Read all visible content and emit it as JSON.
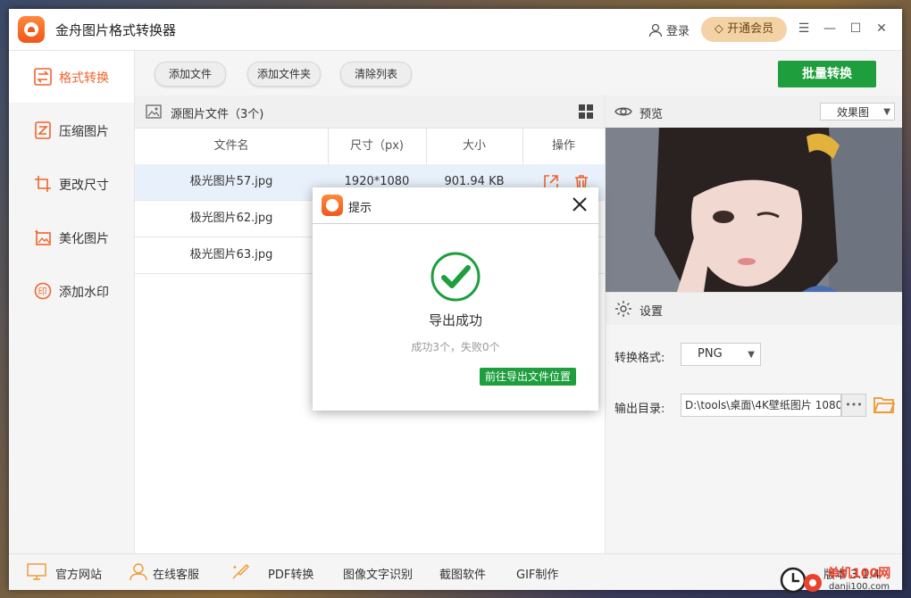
{
  "app": {
    "title": "金舟图片格式转换器",
    "login_label": "登录",
    "vip_label": "开通会员"
  },
  "sidebar": {
    "items": [
      {
        "label": "格式转换",
        "icon": "swap-icon"
      },
      {
        "label": "压缩图片",
        "icon": "compress-icon"
      },
      {
        "label": "更改尺寸",
        "icon": "crop-icon"
      },
      {
        "label": "美化图片",
        "icon": "beautify-icon"
      },
      {
        "label": "添加水印",
        "icon": "watermark-stamp-icon"
      }
    ]
  },
  "toolbar": {
    "add_file": "添加文件",
    "add_folder": "添加文件夹",
    "clear_list": "清除列表",
    "batch_convert": "批量转换"
  },
  "files": {
    "header": "源图片文件（3个)",
    "columns": [
      "文件名",
      "尺寸（px)",
      "大小",
      "操作"
    ],
    "rows": [
      {
        "name": "极光图片57.jpg",
        "size_px": "1920*1080",
        "size": "901.94 KB"
      },
      {
        "name": "极光图片62.jpg",
        "size_px": "",
        "size": ""
      },
      {
        "name": "极光图片63.jpg",
        "size_px": "",
        "size": ""
      }
    ]
  },
  "preview": {
    "title": "预览",
    "mode": "效果图"
  },
  "settings": {
    "title": "设置",
    "format_label": "转换格式:",
    "format_value": "PNG",
    "output_label": "输出目录:",
    "output_value": "D:\\tools\\桌面\\4K壁纸图片 1080",
    "browse_label": "•••"
  },
  "footer": {
    "items": [
      "官方网站",
      "在线客服",
      "PDF转换",
      "图像文字识别",
      "截图软件",
      "GIF制作"
    ],
    "version": "版本 3.1.4"
  },
  "dialog": {
    "title": "提示",
    "message": "导出成功",
    "detail": "成功3个，失败0个",
    "button": "前往导出文件位置"
  },
  "watermark": {
    "site": "单机100网",
    "url": "danji100.com"
  },
  "colors": {
    "accent": "#f0642c",
    "green": "#1e9e3c",
    "vip": "#f3d3a5"
  }
}
